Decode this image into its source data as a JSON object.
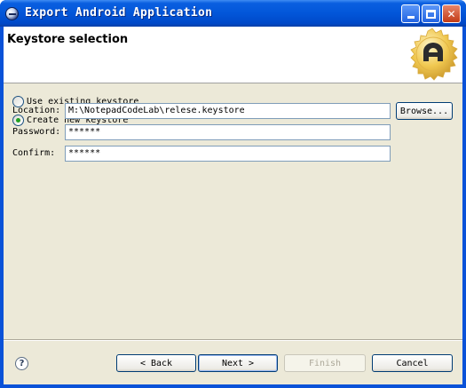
{
  "window": {
    "title": "Export Android Application"
  },
  "banner": {
    "title": "Keystore selection"
  },
  "options": {
    "use_existing": "Use existing keystore",
    "create_new": "Create new keystore",
    "selected": "create_new"
  },
  "form": {
    "location_label": "Location:",
    "location_value": "M:\\NotepadCodeLab\\relese.keystore",
    "browse_label": "Browse...",
    "password_label": "Password:",
    "password_value": "******",
    "confirm_label": "Confirm:",
    "confirm_value": "******"
  },
  "footer": {
    "help": "?",
    "back": "< Back",
    "next": "Next >",
    "finish": "Finish",
    "cancel": "Cancel"
  }
}
